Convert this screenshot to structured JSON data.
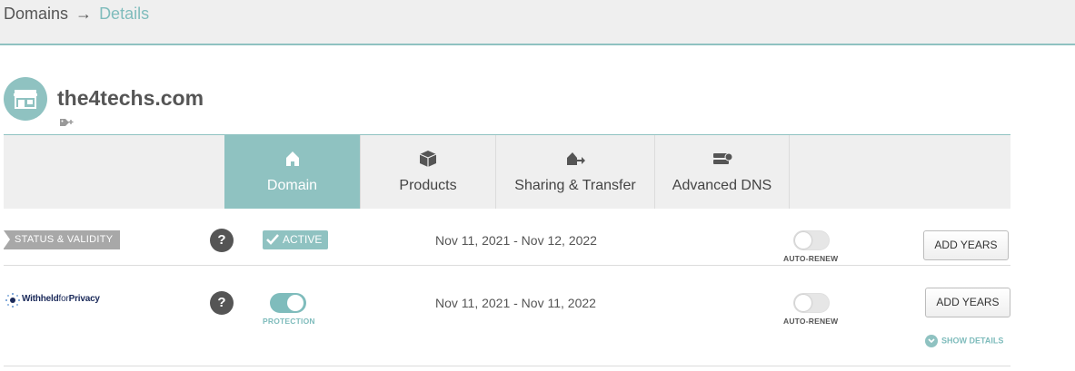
{
  "breadcrumb": {
    "parent": "Domains",
    "separator": "→",
    "current": "Details"
  },
  "domain": {
    "name": "the4techs.com"
  },
  "tabs": [
    {
      "label": "Domain",
      "icon": "home-icon",
      "active": true
    },
    {
      "label": "Products",
      "icon": "box-icon",
      "active": false
    },
    {
      "label": "Sharing & Transfer",
      "icon": "transfer-icon",
      "active": false
    },
    {
      "label": "Advanced DNS",
      "icon": "dns-server-icon",
      "active": false
    }
  ],
  "rows": [
    {
      "label": "STATUS & VALIDITY",
      "help": "?",
      "status": "ACTIVE",
      "dates": "Nov 11, 2021 - Nov 12, 2022",
      "autorenew_label": "AUTO-RENEW",
      "autorenew_on": false,
      "button": "ADD YEARS"
    },
    {
      "brand": "WithheldforPrivacy",
      "brand_bold": "Withheld",
      "brand_light": "for",
      "brand_bold2": "Privacy",
      "help": "?",
      "protection_label": "PROTECTION",
      "protection_on": true,
      "dates": "Nov 11, 2021 - Nov 11, 2022",
      "autorenew_label": "AUTO-RENEW",
      "autorenew_on": false,
      "button": "ADD YEARS",
      "show_details": "SHOW DETAILS"
    }
  ],
  "colors": {
    "accent": "#8fc2c1",
    "accent_text": "#7fbcbc",
    "label_bg": "#a8a8a8"
  }
}
